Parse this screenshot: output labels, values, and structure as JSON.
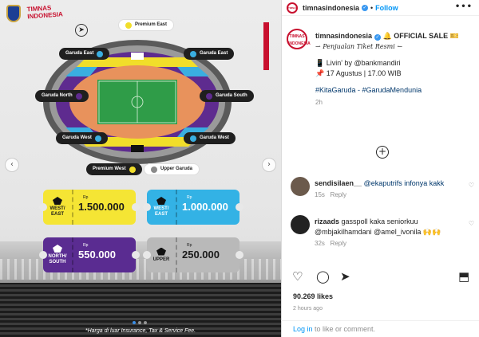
{
  "post": {
    "username": "timnasindonesia",
    "follow_label": "Follow",
    "more_glyph": "•••",
    "sep": "•"
  },
  "poster": {
    "brand_text": "TIMNAS INDONESIA",
    "compass_glyph": "➤",
    "zones": {
      "premium_east": "Premium East",
      "garuda_east_left": "Garuda East",
      "garuda_east_right": "Garuda East",
      "garuda_north": "Garuda North",
      "garuda_south": "Garuda South",
      "garuda_west_left": "Garuda West",
      "garuda_west_right": "Garuda West",
      "premium_west": "Premium West",
      "upper_garuda": "Upper Garuda"
    },
    "tickets": [
      {
        "zone": "WEST/ EAST",
        "rp": "Rp",
        "price": "1.500.000"
      },
      {
        "zone": "WEST/ EAST",
        "rp": "Rp",
        "price": "1.000.000"
      },
      {
        "zone": "NORTH/ SOUTH",
        "rp": "Rp",
        "price": "550.000"
      },
      {
        "zone": "UPPER",
        "rp": "Rp",
        "price": "250.000"
      }
    ],
    "garuda_word": "Garuda",
    "footnote": "*Harga di luar Insurance, Tax & Service Fee.",
    "prev_glyph": "‹",
    "next_glyph": "›"
  },
  "caption": {
    "username": "timnasindonesia",
    "title": "OFFICIAL SALE",
    "title_emoji": "🔔",
    "sale_emoji": "🎫",
    "subtitle": "⇀ Penjualan Tiket Resmi ↼",
    "line1": "📱 Livin' by @bankmandiri",
    "line2": "📌 17 Agustus | 17.00 WIB",
    "tags": "#KitaGaruda - #GarudaMendunia",
    "time": "2h",
    "add_glyph": "+"
  },
  "comments": [
    {
      "user": "sendisilaen__",
      "text": "@ekaputrifs infonya kakk",
      "time": "15s",
      "reply": "Reply"
    },
    {
      "user": "rizaads",
      "text": "gasspoll kaka seniorkuu @mbjakilhamdani @amel_ivonila 🙌🙌",
      "time": "32s",
      "reply": "Reply"
    }
  ],
  "actions": {
    "like_glyph": "♡",
    "comment_glyph": "◯",
    "share_glyph": "➤",
    "save_glyph": "⬒"
  },
  "likes": "90.269 likes",
  "ago": "2 hours ago",
  "login": {
    "link": "Log in",
    "rest": " to like or comment."
  }
}
